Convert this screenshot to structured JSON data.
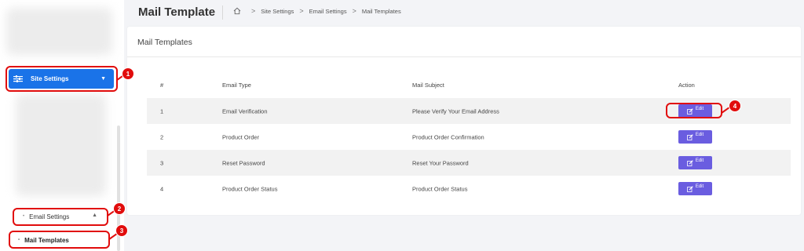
{
  "page": {
    "title": "Mail Template"
  },
  "breadcrumb": [
    "Site Settings",
    "Email Settings",
    "Mail Templates"
  ],
  "sidebar": {
    "site_settings": "Site Settings",
    "email_settings": "Email Settings",
    "mail_templates": "Mail Templates"
  },
  "callouts": [
    "1",
    "2",
    "3",
    "4"
  ],
  "card": {
    "title": "Mail Templates"
  },
  "table": {
    "headers": [
      "#",
      "Email Type",
      "Mail Subject",
      "Action"
    ],
    "rows": [
      {
        "num": "1",
        "type": "Email Verification",
        "subject": "Please Verify Your Email Address",
        "action": "Edit"
      },
      {
        "num": "2",
        "type": "Product Order",
        "subject": "Product Order Confirmation",
        "action": "Edit"
      },
      {
        "num": "3",
        "type": "Reset Password",
        "subject": "Reset Your Password",
        "action": "Edit"
      },
      {
        "num": "4",
        "type": "Product Order Status",
        "subject": "Product Order Status",
        "action": "Edit"
      }
    ]
  },
  "colors": {
    "primary": "#1a73e8",
    "edit": "#6a5de0",
    "callout": "#e10c0c"
  },
  "icons": {
    "settings": "sliders-icon",
    "home": "home-icon",
    "edit": "edit-icon"
  }
}
